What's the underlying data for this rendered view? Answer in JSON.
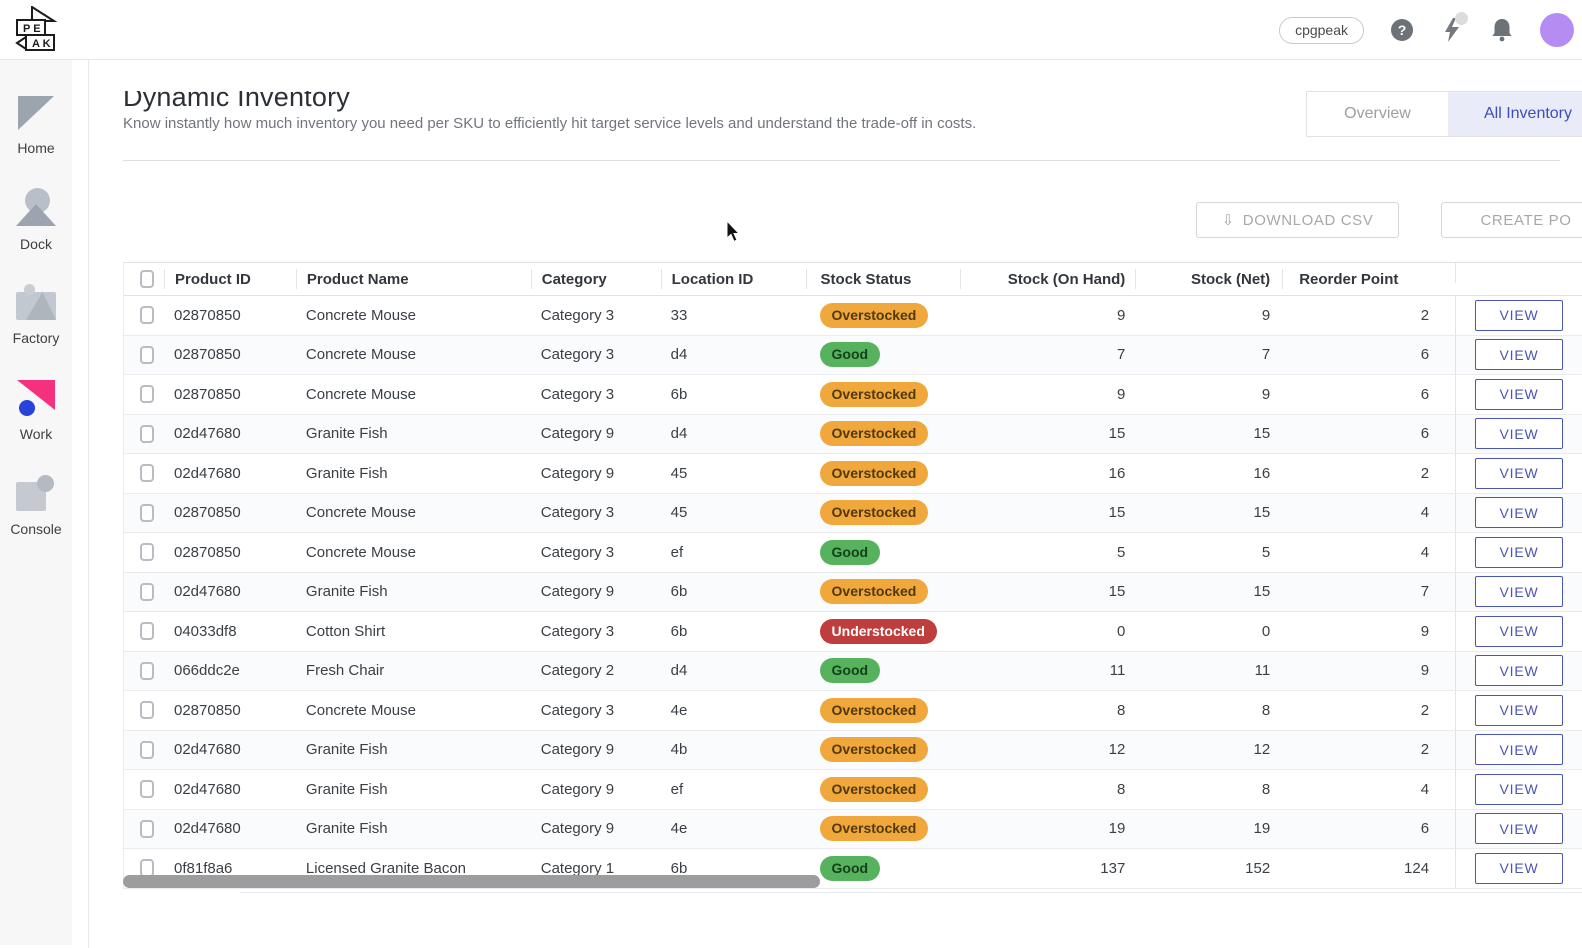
{
  "topbar": {
    "logo": "PEAK",
    "account_badge": "cpgpeak",
    "help_glyph": "?"
  },
  "sidebar": {
    "items": [
      {
        "label": "Home",
        "active": false
      },
      {
        "label": "Dock",
        "active": false
      },
      {
        "label": "Factory",
        "active": false
      },
      {
        "label": "Work",
        "active": true
      },
      {
        "label": "Console",
        "active": false
      }
    ]
  },
  "page": {
    "title": "Dynamic Inventory",
    "subtitle": "Know instantly how much inventory you need per SKU to efficiently hit target service levels and understand the trade-off in costs.",
    "tabs": [
      {
        "label": "Overview",
        "active": false
      },
      {
        "label": "All Inventory",
        "active": true
      }
    ],
    "actions": {
      "download_csv_label": "DOWNLOAD CSV",
      "download_icon": "⇩",
      "create_po_label": "CREATE PO"
    }
  },
  "table": {
    "columns": [
      "Product ID",
      "Product Name",
      "Category",
      "Location ID",
      "Stock Status",
      "Stock (On Hand)",
      "Stock (Net)",
      "Reorder Point"
    ],
    "view_label": "VIEW",
    "status_styles": {
      "Overstocked": {
        "bg": "#f0a73c",
        "fg": "#50390a"
      },
      "Good": {
        "bg": "#57b25e",
        "fg": "#14401a"
      },
      "Understocked": {
        "bg": "#bf3d3d",
        "fg": "#ffffff"
      }
    },
    "rows": [
      {
        "product_id": "02870850",
        "product_name": "Concrete Mouse",
        "category": "Category 3",
        "location_id": "33",
        "status": "Overstocked",
        "on_hand": "9",
        "net": "9",
        "reorder": "2"
      },
      {
        "product_id": "02870850",
        "product_name": "Concrete Mouse",
        "category": "Category 3",
        "location_id": "d4",
        "status": "Good",
        "on_hand": "7",
        "net": "7",
        "reorder": "6"
      },
      {
        "product_id": "02870850",
        "product_name": "Concrete Mouse",
        "category": "Category 3",
        "location_id": "6b",
        "status": "Overstocked",
        "on_hand": "9",
        "net": "9",
        "reorder": "6"
      },
      {
        "product_id": "02d47680",
        "product_name": "Granite Fish",
        "category": "Category 9",
        "location_id": "d4",
        "status": "Overstocked",
        "on_hand": "15",
        "net": "15",
        "reorder": "6"
      },
      {
        "product_id": "02d47680",
        "product_name": "Granite Fish",
        "category": "Category 9",
        "location_id": "45",
        "status": "Overstocked",
        "on_hand": "16",
        "net": "16",
        "reorder": "2"
      },
      {
        "product_id": "02870850",
        "product_name": "Concrete Mouse",
        "category": "Category 3",
        "location_id": "45",
        "status": "Overstocked",
        "on_hand": "15",
        "net": "15",
        "reorder": "4"
      },
      {
        "product_id": "02870850",
        "product_name": "Concrete Mouse",
        "category": "Category 3",
        "location_id": "ef",
        "status": "Good",
        "on_hand": "5",
        "net": "5",
        "reorder": "4"
      },
      {
        "product_id": "02d47680",
        "product_name": "Granite Fish",
        "category": "Category 9",
        "location_id": "6b",
        "status": "Overstocked",
        "on_hand": "15",
        "net": "15",
        "reorder": "7"
      },
      {
        "product_id": "04033df8",
        "product_name": "Cotton Shirt",
        "category": "Category 3",
        "location_id": "6b",
        "status": "Understocked",
        "on_hand": "0",
        "net": "0",
        "reorder": "9"
      },
      {
        "product_id": "066ddc2e",
        "product_name": "Fresh Chair",
        "category": "Category 2",
        "location_id": "d4",
        "status": "Good",
        "on_hand": "11",
        "net": "11",
        "reorder": "9"
      },
      {
        "product_id": "02870850",
        "product_name": "Concrete Mouse",
        "category": "Category 3",
        "location_id": "4e",
        "status": "Overstocked",
        "on_hand": "8",
        "net": "8",
        "reorder": "2"
      },
      {
        "product_id": "02d47680",
        "product_name": "Granite Fish",
        "category": "Category 9",
        "location_id": "4b",
        "status": "Overstocked",
        "on_hand": "12",
        "net": "12",
        "reorder": "2"
      },
      {
        "product_id": "02d47680",
        "product_name": "Granite Fish",
        "category": "Category 9",
        "location_id": "ef",
        "status": "Overstocked",
        "on_hand": "8",
        "net": "8",
        "reorder": "4"
      },
      {
        "product_id": "02d47680",
        "product_name": "Granite Fish",
        "category": "Category 9",
        "location_id": "4e",
        "status": "Overstocked",
        "on_hand": "19",
        "net": "19",
        "reorder": "6"
      },
      {
        "product_id": "0f81f8a6",
        "product_name": "Licensed Granite Bacon",
        "category": "Category 1",
        "location_id": "6b",
        "status": "Good",
        "on_hand": "137",
        "net": "152",
        "reorder": "124"
      }
    ]
  }
}
